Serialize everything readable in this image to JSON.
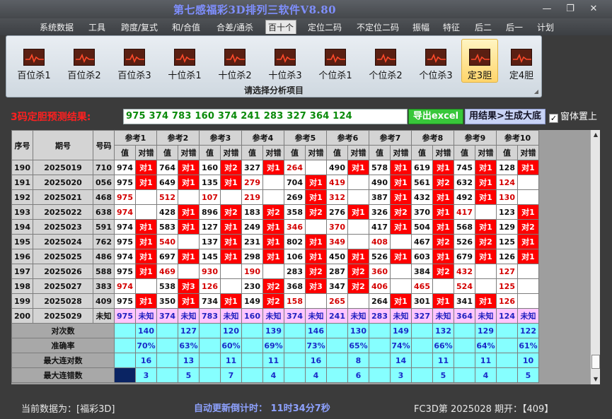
{
  "app": {
    "title": "第七感福彩3D排列三软件V8.80"
  },
  "menu": [
    "系统数据",
    "工具",
    "跨度/复式",
    "和/合值",
    "合差/通杀",
    "百十个",
    "定位二码",
    "不定位二码",
    "振幅",
    "特征",
    "后二",
    "后一",
    "计划"
  ],
  "menu_active": "百十个",
  "ribbon": {
    "buttons": [
      {
        "label": "百位杀1",
        "icon": "chart-icon"
      },
      {
        "label": "百位杀2",
        "icon": "chart-icon"
      },
      {
        "label": "百位杀3",
        "icon": "chart-icon"
      },
      {
        "label": "十位杀1",
        "icon": "chart-icon"
      },
      {
        "label": "十位杀2",
        "icon": "chart-icon"
      },
      {
        "label": "十位杀3",
        "icon": "chart-icon"
      },
      {
        "label": "个位杀1",
        "icon": "chart-icon"
      },
      {
        "label": "个位杀2",
        "icon": "chart-icon"
      },
      {
        "label": "个位杀3",
        "icon": "chart-icon"
      },
      {
        "label": "定3胆",
        "icon": "chart-icon"
      },
      {
        "label": "定4胆",
        "icon": "chart-icon"
      }
    ],
    "active_button": "定3胆",
    "caption": "请选择分析项目"
  },
  "result": {
    "label": "3码定胆预测结果:",
    "value": "975 374 783 160 374 241 283 327 364 124",
    "export_button": "导出excel",
    "generate_button": "用结果>生成大底",
    "ontop_label": "窗体置上",
    "ontop_checked": true
  },
  "table": {
    "headers": {
      "seq": "序号",
      "period": "期号",
      "number": "号码",
      "value": "值",
      "hit": "对错"
    },
    "ref_labels": [
      "参考1",
      "参考2",
      "参考3",
      "参考4",
      "参考5",
      "参考6",
      "参考7",
      "参考8",
      "参考9",
      "参考10"
    ],
    "rows": [
      {
        "seq": "190",
        "period": "2025019",
        "number": "710",
        "cells": [
          [
            "974",
            "对1"
          ],
          [
            "764",
            "对1"
          ],
          [
            "160",
            "对2"
          ],
          [
            "327",
            "对1"
          ],
          [
            "264",
            ""
          ],
          [
            "490",
            "对1"
          ],
          [
            "578",
            "对1"
          ],
          [
            "619",
            "对1"
          ],
          [
            "745",
            "对1"
          ],
          [
            "128",
            "对1"
          ]
        ]
      },
      {
        "seq": "191",
        "period": "2025020",
        "number": "056",
        "cells": [
          [
            "975",
            "对1"
          ],
          [
            "649",
            "对1"
          ],
          [
            "135",
            "对1"
          ],
          [
            "279",
            ""
          ],
          [
            "704",
            "对1"
          ],
          [
            "419",
            ""
          ],
          [
            "490",
            "对1"
          ],
          [
            "561",
            "对2"
          ],
          [
            "632",
            "对1"
          ],
          [
            "124",
            ""
          ]
        ]
      },
      {
        "seq": "192",
        "period": "2025021",
        "number": "468",
        "cells": [
          [
            "975",
            ""
          ],
          [
            "512",
            ""
          ],
          [
            "107",
            ""
          ],
          [
            "219",
            ""
          ],
          [
            "269",
            "对1"
          ],
          [
            "312",
            ""
          ],
          [
            "387",
            "对1"
          ],
          [
            "432",
            "对1"
          ],
          [
            "492",
            "对1"
          ],
          [
            "130",
            ""
          ]
        ]
      },
      {
        "seq": "193",
        "period": "2025022",
        "number": "638",
        "cells": [
          [
            "974",
            ""
          ],
          [
            "428",
            "对1"
          ],
          [
            "896",
            "对2"
          ],
          [
            "183",
            "对2"
          ],
          [
            "358",
            "对2"
          ],
          [
            "276",
            "对1"
          ],
          [
            "326",
            "对2"
          ],
          [
            "370",
            "对1"
          ],
          [
            "417",
            ""
          ],
          [
            "123",
            "对1"
          ]
        ]
      },
      {
        "seq": "194",
        "period": "2025023",
        "number": "591",
        "cells": [
          [
            "974",
            "对1"
          ],
          [
            "583",
            "对1"
          ],
          [
            "127",
            "对1"
          ],
          [
            "249",
            "对1"
          ],
          [
            "346",
            ""
          ],
          [
            "370",
            ""
          ],
          [
            "417",
            "对1"
          ],
          [
            "504",
            "对1"
          ],
          [
            "568",
            "对1"
          ],
          [
            "129",
            "对2"
          ]
        ]
      },
      {
        "seq": "195",
        "period": "2025024",
        "number": "762",
        "cells": [
          [
            "975",
            "对1"
          ],
          [
            "540",
            ""
          ],
          [
            "137",
            "对1"
          ],
          [
            "231",
            "对1"
          ],
          [
            "802",
            "对1"
          ],
          [
            "349",
            ""
          ],
          [
            "408",
            ""
          ],
          [
            "467",
            "对2"
          ],
          [
            "526",
            "对2"
          ],
          [
            "125",
            "对1"
          ]
        ]
      },
      {
        "seq": "196",
        "period": "2025025",
        "number": "486",
        "cells": [
          [
            "974",
            "对1"
          ],
          [
            "697",
            "对1"
          ],
          [
            "145",
            "对1"
          ],
          [
            "298",
            "对1"
          ],
          [
            "106",
            "对1"
          ],
          [
            "450",
            "对1"
          ],
          [
            "526",
            "对1"
          ],
          [
            "603",
            "对1"
          ],
          [
            "679",
            "对1"
          ],
          [
            "126",
            "对1"
          ]
        ]
      },
      {
        "seq": "197",
        "period": "2025026",
        "number": "588",
        "cells": [
          [
            "975",
            "对1"
          ],
          [
            "469",
            ""
          ],
          [
            "930",
            ""
          ],
          [
            "190",
            ""
          ],
          [
            "283",
            "对2"
          ],
          [
            "287",
            "对2"
          ],
          [
            "360",
            ""
          ],
          [
            "384",
            "对2"
          ],
          [
            "432",
            ""
          ],
          [
            "127",
            ""
          ]
        ]
      },
      {
        "seq": "198",
        "period": "2025027",
        "number": "383",
        "cells": [
          [
            "974",
            ""
          ],
          [
            "538",
            "对3"
          ],
          [
            "126",
            ""
          ],
          [
            "230",
            "对2"
          ],
          [
            "368",
            "对3"
          ],
          [
            "347",
            "对2"
          ],
          [
            "406",
            ""
          ],
          [
            "465",
            ""
          ],
          [
            "524",
            ""
          ],
          [
            "125",
            ""
          ]
        ]
      },
      {
        "seq": "199",
        "period": "2025028",
        "number": "409",
        "cells": [
          [
            "975",
            "对1"
          ],
          [
            "350",
            "对1"
          ],
          [
            "734",
            "对1"
          ],
          [
            "149",
            "对2"
          ],
          [
            "158",
            ""
          ],
          [
            "265",
            ""
          ],
          [
            "264",
            "对1"
          ],
          [
            "301",
            "对1"
          ],
          [
            "341",
            "对1"
          ],
          [
            "126",
            ""
          ]
        ]
      }
    ],
    "prediction_row": {
      "seq": "200",
      "period": "2025029",
      "number": "未知",
      "values": [
        "975",
        "374",
        "783",
        "160",
        "374",
        "241",
        "283",
        "327",
        "364",
        "124"
      ],
      "hit_text": "未知"
    },
    "stats": [
      {
        "label": "对次数",
        "values": [
          "140",
          "127",
          "120",
          "139",
          "146",
          "130",
          "149",
          "132",
          "129",
          "122"
        ]
      },
      {
        "label": "准确率",
        "values": [
          "70%",
          "63%",
          "60%",
          "69%",
          "73%",
          "65%",
          "74%",
          "66%",
          "64%",
          "61%"
        ]
      },
      {
        "label": "最大连对数",
        "values": [
          "16",
          "13",
          "11",
          "11",
          "16",
          "8",
          "14",
          "11",
          "11",
          "10"
        ]
      },
      {
        "label": "最大连错数",
        "values": [
          "3",
          "5",
          "7",
          "4",
          "4",
          "6",
          "3",
          "5",
          "4",
          "5"
        ]
      }
    ]
  },
  "statusbar": {
    "current_data": "当前数据为：[福彩3D]",
    "countdown": "自动更新倒计时：  11时34分7秒",
    "period_info": "FC3D第 2025028 期开：【409】"
  }
}
